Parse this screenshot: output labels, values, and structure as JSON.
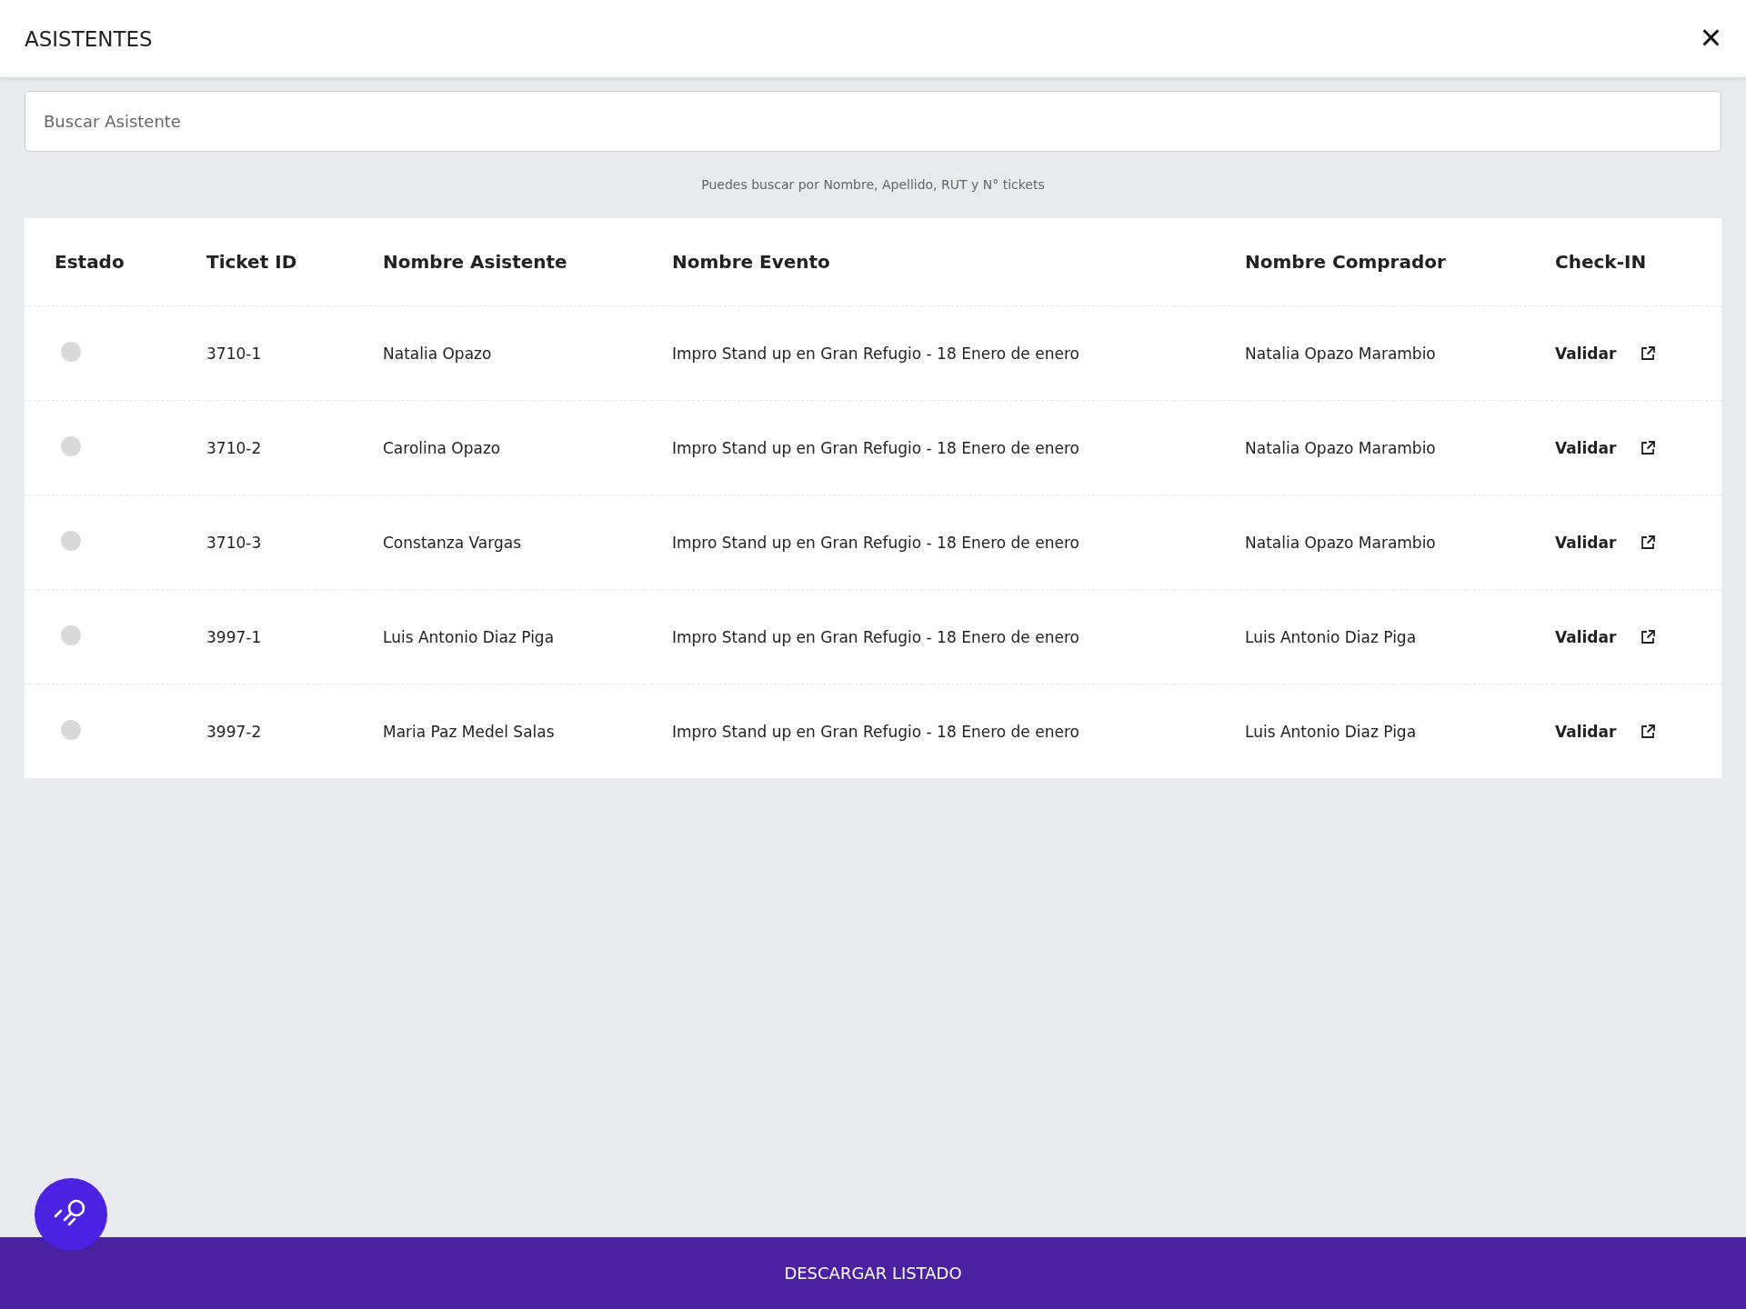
{
  "header": {
    "title": "ASISTENTES",
    "close": "×"
  },
  "search": {
    "placeholder": "Buscar Asistente",
    "hint": "Puedes buscar por Nombre, Apellido, RUT y N° tickets"
  },
  "table": {
    "columns": [
      "Estado",
      "Ticket ID",
      "Nombre Asistente",
      "Nombre Evento",
      "Nombre Comprador",
      "Check-IN"
    ],
    "rows": [
      {
        "checked_in": false,
        "ticket": "3710-1",
        "attendee": "Natalia Opazo",
        "event": "Impro Stand up en Gran Refugio - 18 Enero de enero",
        "buyer": "Natalia Opazo Marambio",
        "action": "Validar"
      },
      {
        "checked_in": false,
        "ticket": "3710-2",
        "attendee": "Carolina Opazo",
        "event": "Impro Stand up en Gran Refugio - 18 Enero de enero",
        "buyer": "Natalia Opazo Marambio",
        "action": "Validar"
      },
      {
        "checked_in": false,
        "ticket": "3710-3",
        "attendee": "Constanza Vargas",
        "event": "Impro Stand up en Gran Refugio - 18 Enero de enero",
        "buyer": "Natalia Opazo Marambio",
        "action": "Validar"
      },
      {
        "checked_in": false,
        "ticket": "3997-1",
        "attendee": "Luis Antonio Diaz Piga",
        "event": "Impro Stand up en Gran Refugio - 18 Enero de enero",
        "buyer": "Luis Antonio Diaz Piga",
        "action": "Validar"
      },
      {
        "checked_in": false,
        "ticket": "3997-2",
        "attendee": "Maria Paz Medel Salas",
        "event": "Impro Stand up en Gran Refugio - 18 Enero de enero",
        "buyer": "Luis Antonio Diaz Piga",
        "action": "Validar"
      }
    ]
  },
  "footer": {
    "button": "DESCARGAR LISTADO"
  }
}
